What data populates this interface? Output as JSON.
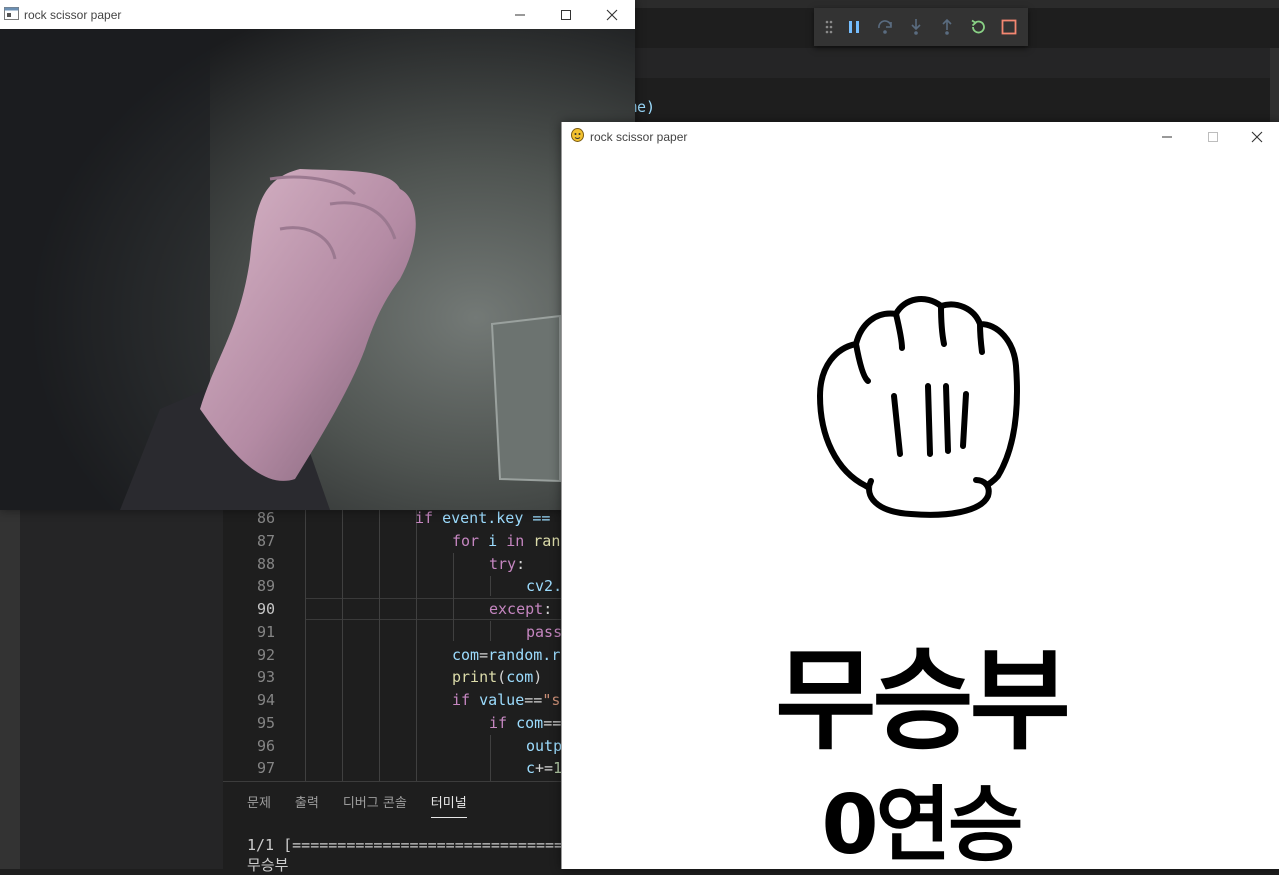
{
  "debug_toolbar": {
    "buttons": [
      "drag-handle-icon",
      "pause-icon",
      "step-over-icon",
      "step-into-icon",
      "step-out-icon",
      "restart-icon",
      "stop-icon"
    ],
    "colors": {
      "pause": "#75beff",
      "step": "#75beff",
      "restart": "#89d185",
      "stop": "#f48771"
    }
  },
  "editor": {
    "behind_fragment": "me)",
    "active_line": 90,
    "lines": [
      {
        "num": "86",
        "tokens": [
          {
            "t": "if",
            "c": "kw"
          },
          {
            "t": " event.key == ",
            "c": "var"
          }
        ]
      },
      {
        "num": "87",
        "tokens": [
          {
            "t": "for",
            "c": "kw"
          },
          {
            "t": " i ",
            "c": "var"
          },
          {
            "t": "in",
            "c": "kw"
          },
          {
            "t": " ran",
            "c": "fn"
          }
        ]
      },
      {
        "num": "88",
        "tokens": [
          {
            "t": "try",
            "c": "kw"
          },
          {
            "t": ":",
            "c": "pl"
          }
        ]
      },
      {
        "num": "89",
        "tokens": [
          {
            "t": "cv2.",
            "c": "var"
          }
        ]
      },
      {
        "num": "90",
        "tokens": [
          {
            "t": "except",
            "c": "kw"
          },
          {
            "t": ":",
            "c": "pl"
          }
        ]
      },
      {
        "num": "91",
        "tokens": [
          {
            "t": "pass",
            "c": "kw"
          }
        ]
      },
      {
        "num": "92",
        "tokens": [
          {
            "t": "com",
            "c": "var"
          },
          {
            "t": "=",
            "c": "pl"
          },
          {
            "t": "random.r",
            "c": "var"
          }
        ]
      },
      {
        "num": "93",
        "tokens": [
          {
            "t": "print",
            "c": "fn"
          },
          {
            "t": "(",
            "c": "pl"
          },
          {
            "t": "com",
            "c": "var"
          },
          {
            "t": ")",
            "c": "pl"
          }
        ]
      },
      {
        "num": "94",
        "tokens": [
          {
            "t": "if",
            "c": "kw"
          },
          {
            "t": " value",
            "c": "var"
          },
          {
            "t": "==",
            "c": "pl"
          },
          {
            "t": "\"s",
            "c": "str"
          }
        ]
      },
      {
        "num": "95",
        "tokens": [
          {
            "t": "if",
            "c": "kw"
          },
          {
            "t": " com",
            "c": "var"
          },
          {
            "t": "==",
            "c": "pl"
          }
        ]
      },
      {
        "num": "96",
        "tokens": [
          {
            "t": "outp",
            "c": "var"
          }
        ]
      },
      {
        "num": "97",
        "tokens": [
          {
            "t": "c",
            "c": "var"
          },
          {
            "t": "+=",
            "c": "pl"
          },
          {
            "t": "1",
            "c": "num"
          }
        ]
      }
    ]
  },
  "panel": {
    "tabs": [
      "문제",
      "출력",
      "디버그 콘솔",
      "터미널"
    ],
    "active_tab": 3,
    "terminal_lines": [
      "1/1 [==============================",
      "무승부"
    ]
  },
  "camera_window": {
    "title": "rock scissor paper"
  },
  "game_window": {
    "title": "rock scissor paper",
    "computer_choice": "rock-hand-icon",
    "result": "무승부",
    "streak": "0연승"
  }
}
